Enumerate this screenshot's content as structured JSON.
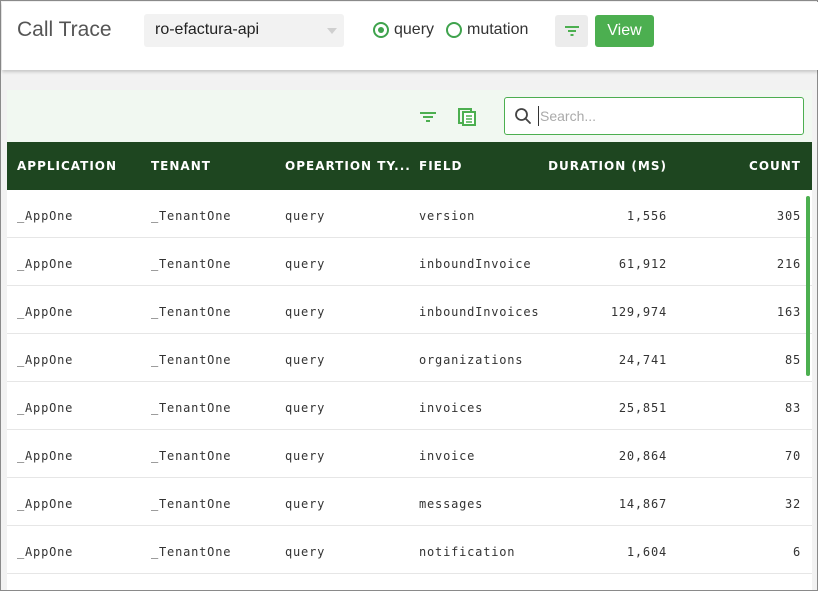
{
  "header": {
    "title": "Call Trace",
    "select_value": "ro-efactura-api",
    "radio_query": "query",
    "radio_mutation": "mutation",
    "selected": "query",
    "view_label": "View"
  },
  "toolbar": {
    "search_placeholder": "Search..."
  },
  "table": {
    "columns": [
      "APPLICATION",
      "TENANT",
      "OPEARTION TY...",
      "FIELD",
      "DURATION (MS)",
      "COUNT"
    ],
    "rows": [
      {
        "application": "_AppOne",
        "tenant": "_TenantOne",
        "operation": "query",
        "field": "version",
        "duration": "1,556",
        "count": "305"
      },
      {
        "application": "_AppOne",
        "tenant": "_TenantOne",
        "operation": "query",
        "field": "inboundInvoice",
        "duration": "61,912",
        "count": "216"
      },
      {
        "application": "_AppOne",
        "tenant": "_TenantOne",
        "operation": "query",
        "field": "inboundInvoices",
        "duration": "129,974",
        "count": "163"
      },
      {
        "application": "_AppOne",
        "tenant": "_TenantOne",
        "operation": "query",
        "field": "organizations",
        "duration": "24,741",
        "count": "85"
      },
      {
        "application": "_AppOne",
        "tenant": "_TenantOne",
        "operation": "query",
        "field": "invoices",
        "duration": "25,851",
        "count": "83"
      },
      {
        "application": "_AppOne",
        "tenant": "_TenantOne",
        "operation": "query",
        "field": "invoice",
        "duration": "20,864",
        "count": "70"
      },
      {
        "application": "_AppOne",
        "tenant": "_TenantOne",
        "operation": "query",
        "field": "messages",
        "duration": "14,867",
        "count": "32"
      },
      {
        "application": "_AppOne",
        "tenant": "_TenantOne",
        "operation": "query",
        "field": "notification",
        "duration": "1,604",
        "count": "6"
      }
    ]
  },
  "colors": {
    "accent": "#4caf50",
    "header_dark": "#1e4620",
    "toolbar_bg": "#f1f8f1"
  }
}
